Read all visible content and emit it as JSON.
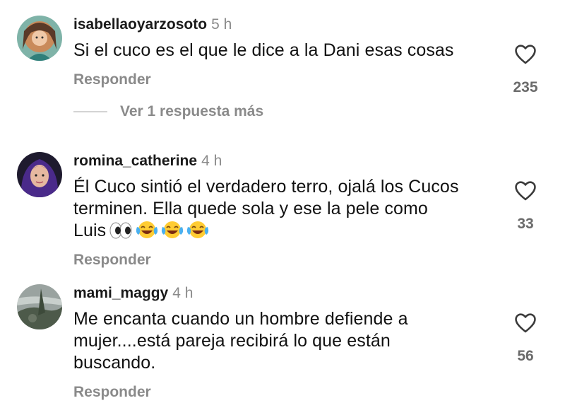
{
  "comments": [
    {
      "username": "isabellaoyarzosoto",
      "time": "5 h",
      "text": "Si el cuco es el que le dice a la Dani esas cosas",
      "reply_label": "Responder",
      "likes": "235",
      "view_replies": "Ver 1 respuesta más"
    },
    {
      "username": "romina_catherine",
      "time": "4 h",
      "text_lines": [
        "Él Cuco sintió el verdadero terro, ojalá los Cucos",
        "terminen. Ella quede sola y ese la pele como",
        "Luis"
      ],
      "emojis": [
        "eyes-emoji",
        "tears-of-joy-emoji",
        "tears-of-joy-emoji",
        "tears-of-joy-emoji"
      ],
      "reply_label": "Responder",
      "likes": "33"
    },
    {
      "username": "mami_maggy",
      "time": "4 h",
      "text_lines": [
        "Me encanta cuando un hombre defiende a",
        "mujer....está pareja recibirá lo que están",
        "buscando."
      ],
      "reply_label": "Responder",
      "likes": "56"
    }
  ],
  "icons": {
    "like": "heart-outline-icon"
  },
  "colors": {
    "secondary_text": "#8a8a8a",
    "primary_text": "#111111"
  }
}
